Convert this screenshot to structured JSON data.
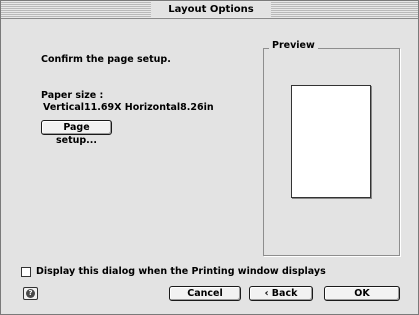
{
  "window": {
    "title": "Layout Options"
  },
  "instruction": "Confirm the page setup.",
  "paper": {
    "label": "Paper size :",
    "value": "Vertical11.69X Horizontal8.26in",
    "setup_button": "Page setup..."
  },
  "preview": {
    "label": "Preview"
  },
  "options": {
    "show_dialog_label": "Display this dialog when the Printing window displays",
    "show_dialog_checked": false
  },
  "buttons": {
    "help_icon": "help-icon",
    "cancel": "Cancel",
    "back": "‹ Back",
    "ok": "OK"
  }
}
